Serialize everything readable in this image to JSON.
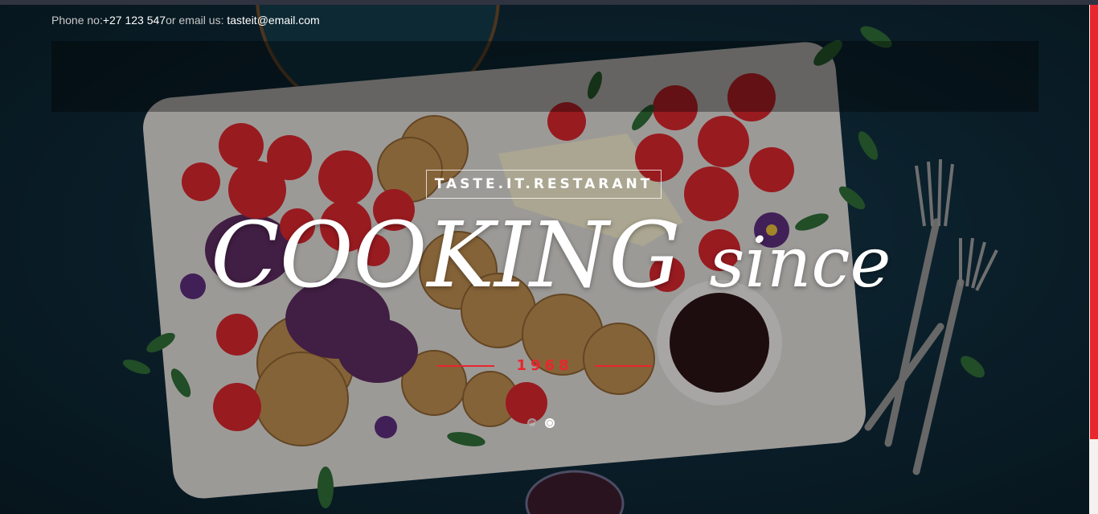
{
  "contact": {
    "phone_label": "Phone no:",
    "phone": "+27 123 547",
    "email_label": "or email us: ",
    "email": "tasteit@email.com"
  },
  "hero": {
    "brand": "TASTE.IT.RESTARANT",
    "headline_main": "COOKING",
    "headline_tail": "since",
    "year": "1968"
  },
  "slider": {
    "slide_count": 2,
    "active_slide": 2
  },
  "colors": {
    "accent": "#e8262e",
    "overlay": "#0a1d27",
    "text": "#ffffff"
  }
}
